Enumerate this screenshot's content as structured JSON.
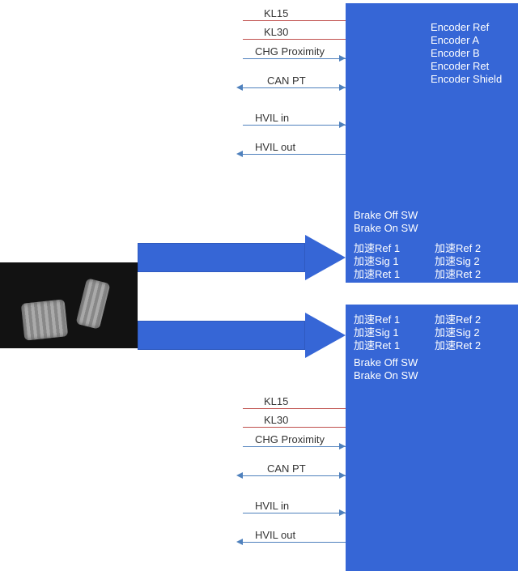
{
  "top": {
    "signals": {
      "kl15": "KL15",
      "kl30": "KL30",
      "chg_prox": "CHG Proximity",
      "can_pt": "CAN PT",
      "hvil_in": "HVIL in",
      "hvil_out": "HVIL out"
    },
    "box": {
      "encoder_ref": "Encoder Ref",
      "encoder_a": "Encoder A",
      "encoder_b": "Encoder B",
      "encoder_ret": "Encoder Ret",
      "encoder_shield": "Encoder Shield",
      "brake_off_sw": "Brake Off SW",
      "brake_on_sw": "Brake On SW",
      "accel_ref_1": "加速Ref 1",
      "accel_sig_1": "加速Sig 1",
      "accel_ret_1": "加速Ret 1",
      "accel_ref_2": "加速Ref 2",
      "accel_sig_2": "加速Sig 2",
      "accel_ret_2": "加速Ret 2"
    }
  },
  "bottom": {
    "signals": {
      "kl15": "KL15",
      "kl30": "KL30",
      "chg_prox": "CHG Proximity",
      "can_pt": "CAN PT",
      "hvil_in": "HVIL in",
      "hvil_out": "HVIL out"
    },
    "box": {
      "brake_off_sw": "Brake Off SW",
      "brake_on_sw": "Brake On SW",
      "accel_ref_1": "加速Ref 1",
      "accel_sig_1": "加速Sig 1",
      "accel_ret_1": "加速Ret 1",
      "accel_ref_2": "加速Ref 2",
      "accel_sig_2": "加速Sig 2",
      "accel_ret_2": "加速Ret 2"
    }
  },
  "chart_data": {
    "type": "diagram",
    "description": "Vehicle pedal wiring / signal block diagram with two controller blocks.",
    "blocks": [
      {
        "id": "controller_top",
        "inputs_left": [
          "KL15",
          "KL30",
          "CHG Proximity",
          "CAN PT",
          "HVIL in",
          "HVIL out"
        ],
        "signals_right": [
          "Encoder Ref",
          "Encoder A",
          "Encoder B",
          "Encoder Ret",
          "Encoder Shield"
        ],
        "pedal_signals": [
          "Brake Off SW",
          "Brake On SW",
          "加速Ref 1",
          "加速Sig 1",
          "加速Ret 1",
          "加速Ref 2",
          "加速Sig 2",
          "加速Ret 2"
        ]
      },
      {
        "id": "controller_bottom",
        "inputs_left": [
          "KL15",
          "KL30",
          "CHG Proximity",
          "CAN PT",
          "HVIL in",
          "HVIL out"
        ],
        "pedal_signals": [
          "加速Ref 1",
          "加速Sig 1",
          "加速Ret 1",
          "加速Ref 2",
          "加速Sig 2",
          "加速Ret 2",
          "Brake Off SW",
          "Brake On SW"
        ]
      }
    ],
    "source": "pedal-assembly",
    "source_arrows_to": [
      "controller_top",
      "controller_bottom"
    ]
  }
}
